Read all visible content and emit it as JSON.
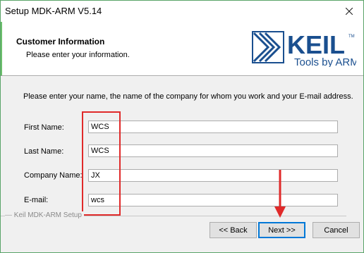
{
  "window": {
    "title": "Setup MDK-ARM V5.14"
  },
  "header": {
    "title": "Customer Information",
    "subtitle": "Please enter your information.",
    "logo_text": "KEIL",
    "logo_tagline": "Tools by ARM",
    "logo_mark": "TM"
  },
  "intro": "Please enter your name, the name of the company for whom you work and your E-mail address.",
  "fields": [
    {
      "label": "First Name:",
      "value": "WCS"
    },
    {
      "label": "Last Name:",
      "value": "WCS"
    },
    {
      "label": "Company Name:",
      "value": "JX"
    },
    {
      "label": "E-mail:",
      "value": "wcs"
    }
  ],
  "group_label": "Keil MDK-ARM Setup",
  "buttons": {
    "back": "<< Back",
    "next": "Next >>",
    "cancel": "Cancel"
  },
  "colors": {
    "highlight": "#e02a2a",
    "logo_blue": "#1a4f8f",
    "arrow": "#e02a2a"
  }
}
